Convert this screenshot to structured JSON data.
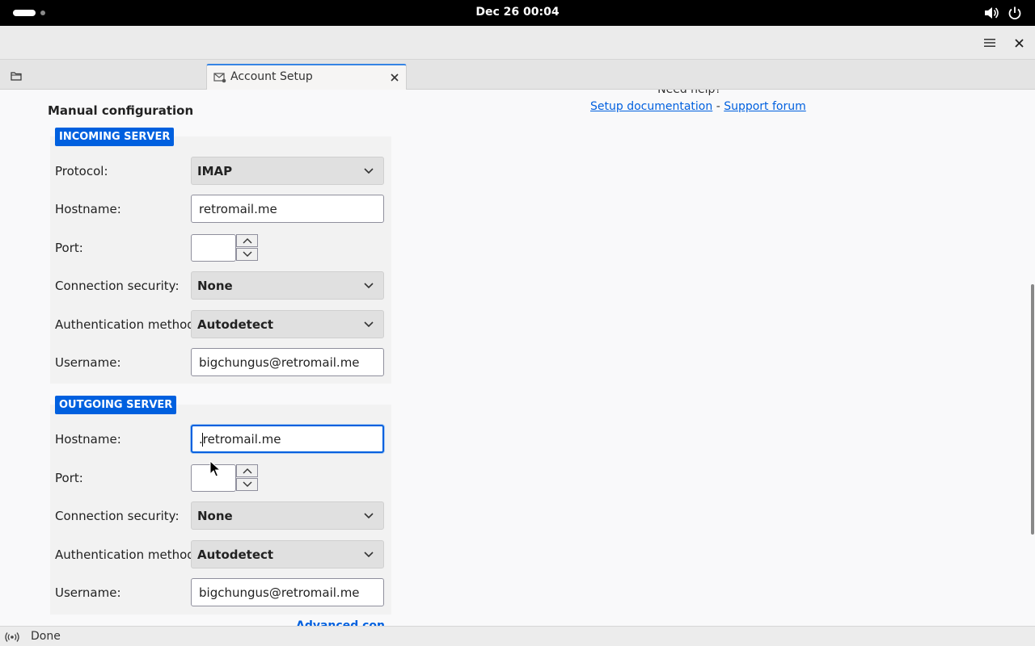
{
  "system_bar": {
    "clock": "Dec 26  00:04"
  },
  "tab": {
    "label": "Account Setup"
  },
  "help": {
    "title": "Need help?",
    "setup_doc_link": "Setup documentation",
    "separator": "-",
    "support_link": "Support forum"
  },
  "manual": {
    "title": "Manual configuration",
    "incoming": {
      "badge": "INCOMING SERVER",
      "protocol_label": "Protocol:",
      "protocol_value": "IMAP",
      "hostname_label": "Hostname:",
      "hostname_value": "retromail.me",
      "port_label": "Port:",
      "port_value": "",
      "security_label": "Connection security:",
      "security_value": "None",
      "auth_label": "Authentication method:",
      "auth_value": "Autodetect",
      "username_label": "Username:",
      "username_value": "bigchungus@retromail.me"
    },
    "outgoing": {
      "badge": "OUTGOING SERVER",
      "hostname_label": "Hostname:",
      "hostname_value": ".retromail.me",
      "port_label": "Port:",
      "port_value": "",
      "security_label": "Connection security:",
      "security_value": "None",
      "auth_label": "Authentication method:",
      "auth_value": "Autodetect",
      "username_label": "Username:",
      "username_value": "bigchungus@retromail.me"
    },
    "advanced_link": "Advanced config"
  },
  "status_bar": {
    "text": "Done"
  },
  "colors": {
    "accent": "#0060df",
    "tab_accent": "#3584e4"
  }
}
